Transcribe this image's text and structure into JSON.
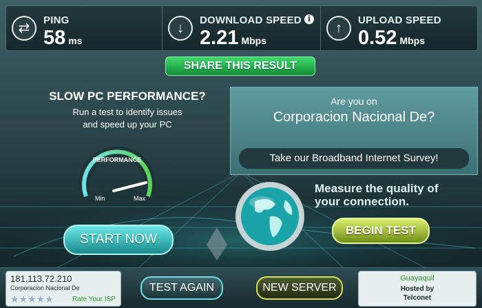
{
  "stats": {
    "ping": {
      "label": "PING",
      "value": "58",
      "unit": "ms",
      "icon": "swap-arrows-icon"
    },
    "download": {
      "label": "DOWNLOAD SPEED",
      "value": "2.21",
      "unit": "Mbps",
      "icon": "arrow-down-icon"
    },
    "upload": {
      "label": "UPLOAD SPEED",
      "value": "0.52",
      "unit": "Mbps",
      "icon": "arrow-up-icon"
    }
  },
  "share_label": "SHARE THIS RESULT",
  "left_panel": {
    "title": "SLOW PC PERFORMANCE?",
    "subtitle_line1": "Run a test to identify issues",
    "subtitle_line2": "and speed up your PC",
    "gauge_label": "PERFORMANCE",
    "gauge_min": "Min",
    "gauge_max": "Max",
    "start_label": "START NOW"
  },
  "right_panel": {
    "question_line1": "Are you on",
    "question_line2": "Corporacion Nacional De?",
    "survey_label": "Take our Broadband Internet Survey!",
    "measure_line1": "Measure the quality of",
    "measure_line2": "your connection.",
    "begin_label": "BEGIN TEST"
  },
  "bottom": {
    "ip": "181.113.72.210",
    "isp": "Corporacion Nacional De",
    "rate_label": "Rate Your ISP",
    "stars": "★★★★★",
    "test_again_label": "TEST AGAIN",
    "new_server_label": "NEW SERVER",
    "server_city": "Guayaquil",
    "hosted_by": "Hosted by",
    "host": "Telconet"
  },
  "colors": {
    "accent_green": "#3fd86a",
    "accent_teal": "#6fe0e6",
    "accent_yellow": "#d6e25a"
  }
}
